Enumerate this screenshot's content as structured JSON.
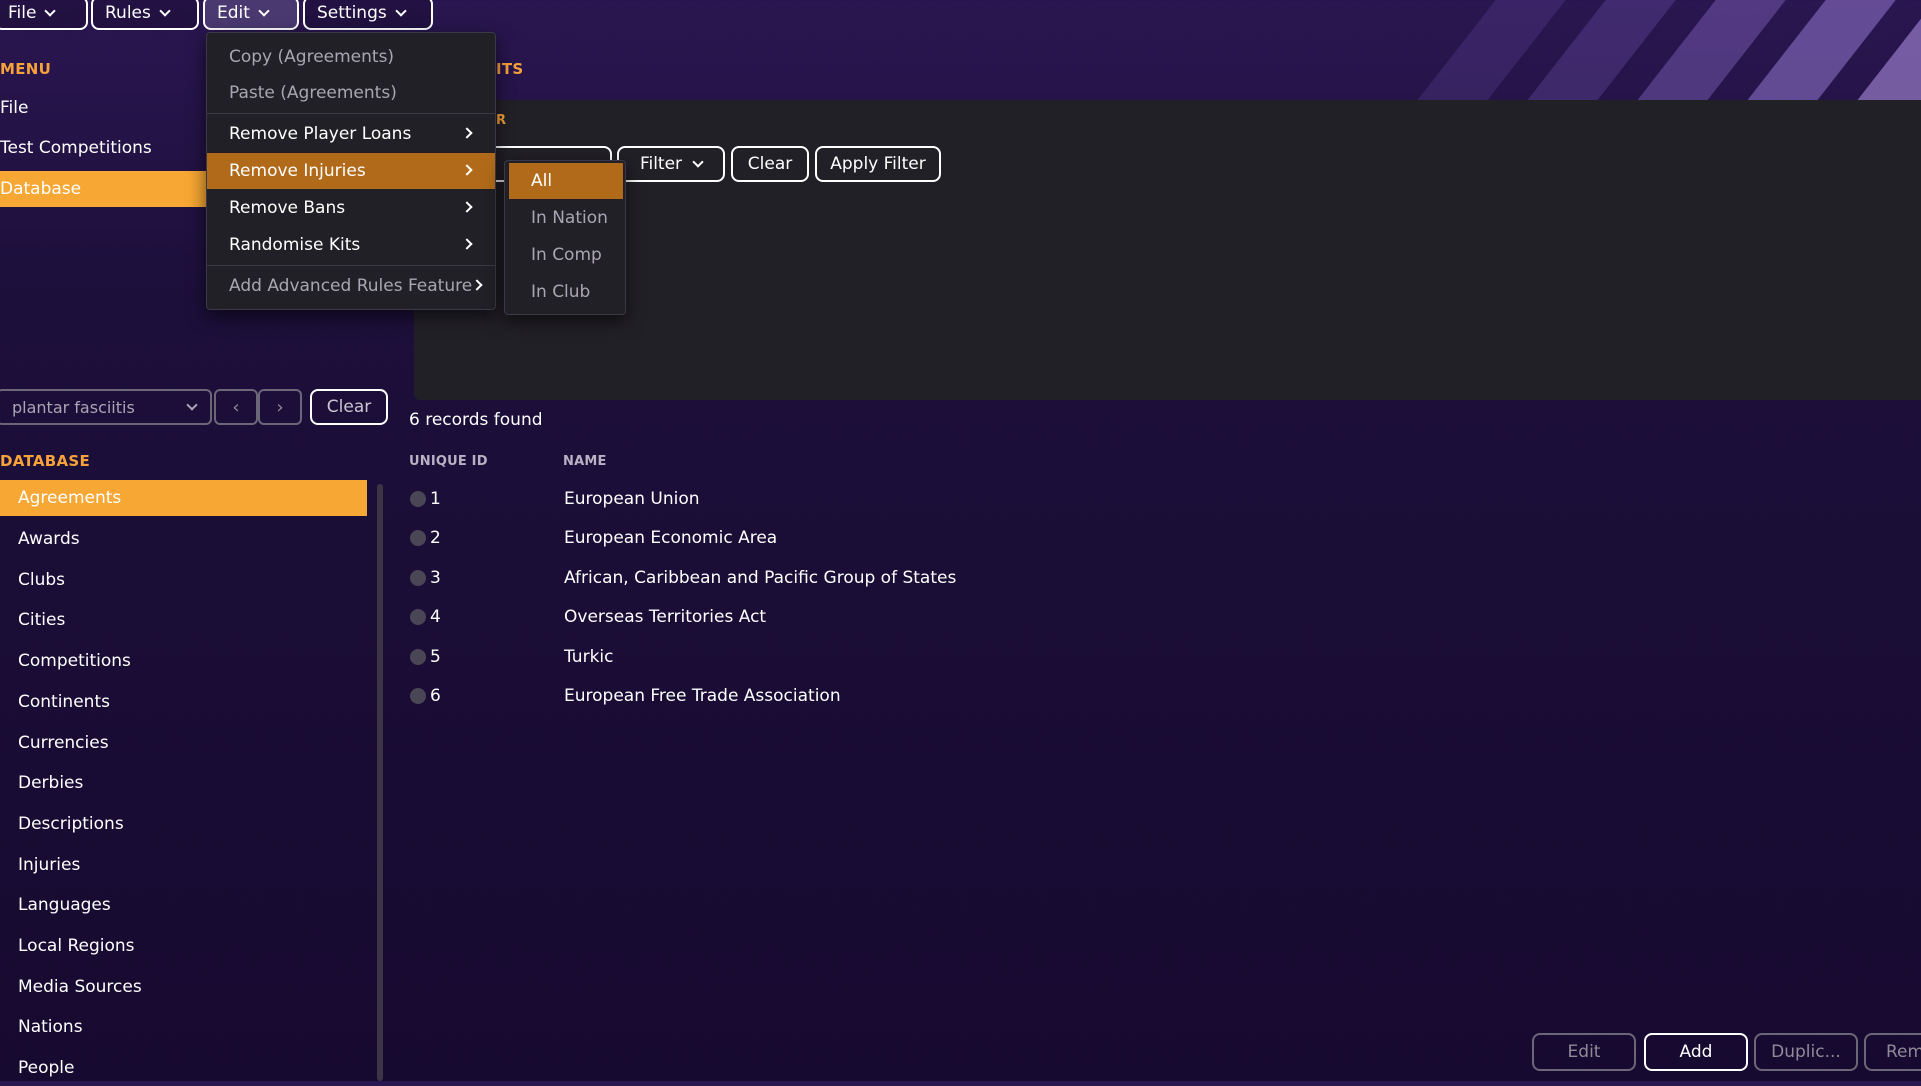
{
  "topbar": {
    "file": "File",
    "rules": "Rules",
    "edit": "Edit",
    "settings": "Settings"
  },
  "left_menu": {
    "heading": "MENU",
    "items": [
      "File",
      "Test Competitions",
      "Database"
    ],
    "selected": "Database"
  },
  "panel": {
    "title_fragment": "ITS",
    "filter_heading_fragment": "R",
    "filter_label": "Filter",
    "clear_label": "Clear",
    "apply_filter_label": "Apply Filter"
  },
  "search": {
    "value": "plantar fasciitis",
    "prev_icon": "chevron-left-icon",
    "next_icon": "chevron-right-icon",
    "clear_label": "Clear"
  },
  "database": {
    "heading": "DATABASE",
    "items": [
      "Agreements",
      "Awards",
      "Clubs",
      "Cities",
      "Competitions",
      "Continents",
      "Currencies",
      "Derbies",
      "Descriptions",
      "Injuries",
      "Languages",
      "Local Regions",
      "Media Sources",
      "Nations",
      "People"
    ],
    "selected": "Agreements"
  },
  "records": {
    "count_text": "6 records found",
    "columns": [
      "UNIQUE ID",
      "NAME"
    ],
    "rows": [
      {
        "id": "1",
        "name": "European Union"
      },
      {
        "id": "2",
        "name": "European Economic Area"
      },
      {
        "id": "3",
        "name": "African, Caribbean and Pacific Group of States"
      },
      {
        "id": "4",
        "name": "Overseas Territories Act"
      },
      {
        "id": "5",
        "name": "Turkic"
      },
      {
        "id": "6",
        "name": "European Free Trade Association"
      }
    ]
  },
  "edit_menu": {
    "items": [
      {
        "label": "Copy (Agreements)",
        "disabled": true
      },
      {
        "label": "Paste (Agreements)",
        "disabled": true
      },
      {
        "label": "Remove Player Loans",
        "submenu": true
      },
      {
        "label": "Remove Injuries",
        "submenu": true,
        "selected": true
      },
      {
        "label": "Remove Bans",
        "submenu": true
      },
      {
        "label": "Randomise Kits",
        "submenu": true
      },
      {
        "label": "Add Advanced Rules Feature",
        "submenu": true,
        "disabled": true
      }
    ]
  },
  "injuries_submenu": {
    "items": [
      "All",
      "In Nation",
      "In Comp",
      "In Club"
    ],
    "selected": "All"
  },
  "bottom_buttons": {
    "edit": "Edit",
    "add": "Add",
    "duplicate": "Duplic...",
    "remove": "Rem"
  },
  "colors": {
    "accent": "#f7a733",
    "menu_highlight": "#b06a19",
    "panel": "#222027"
  }
}
